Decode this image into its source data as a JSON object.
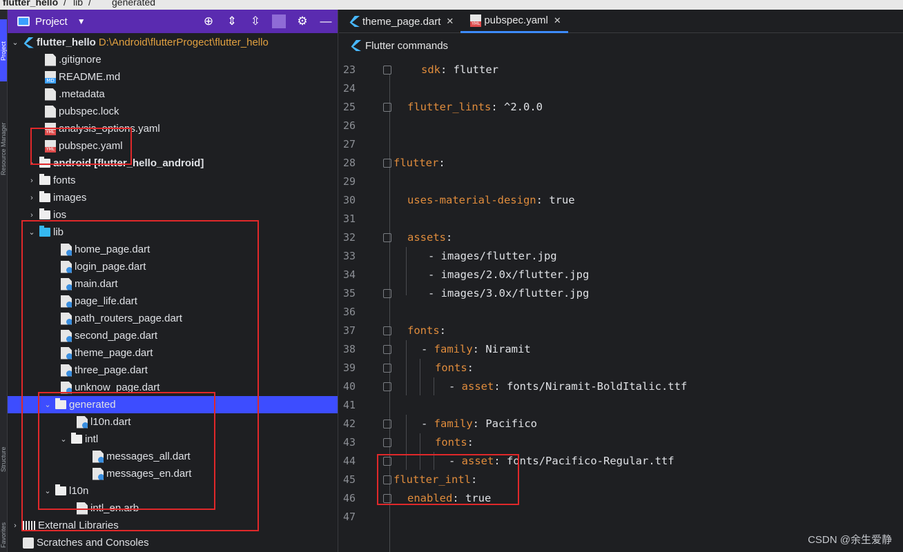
{
  "breadcrumb": {
    "items": [
      "flutter_hello",
      "lib",
      "generated"
    ]
  },
  "toolstrip": {
    "labels": [
      "Project",
      "Resource Manager",
      "Structure",
      "Favorites"
    ]
  },
  "project_panel": {
    "title": "Project",
    "tree": [
      {
        "label": "flutter_hello",
        "path": "D:\\Android\\flutterProgect\\flutter_hello",
        "icon": "flutter-icon",
        "arrow": "down"
      },
      {
        "label": ".gitignore",
        "icon": "file-icon"
      },
      {
        "label": "README.md",
        "icon": "markdown-icon"
      },
      {
        "label": ".metadata",
        "icon": "file-icon"
      },
      {
        "label": "pubspec.lock",
        "icon": "file-icon"
      },
      {
        "label": "analysis_options.yaml",
        "icon": "yaml-icon"
      },
      {
        "label": "pubspec.yaml",
        "icon": "yaml-icon"
      },
      {
        "label": "android [flutter_hello_android]",
        "icon": "folder-icon",
        "arrow": "right"
      },
      {
        "label": "fonts",
        "icon": "folder-icon",
        "arrow": "right"
      },
      {
        "label": "images",
        "icon": "folder-icon",
        "arrow": "right"
      },
      {
        "label": "ios",
        "icon": "folder-icon",
        "arrow": "right"
      },
      {
        "label": "lib",
        "icon": "folder-icon",
        "arrow": "down"
      },
      {
        "label": "home_page.dart",
        "icon": "dart-file-icon"
      },
      {
        "label": "login_page.dart",
        "icon": "dart-file-icon"
      },
      {
        "label": "main.dart",
        "icon": "dart-file-icon"
      },
      {
        "label": "page_life.dart",
        "icon": "dart-file-icon"
      },
      {
        "label": "path_routers_page.dart",
        "icon": "dart-file-icon"
      },
      {
        "label": "second_page.dart",
        "icon": "dart-file-icon"
      },
      {
        "label": "theme_page.dart",
        "icon": "dart-file-icon"
      },
      {
        "label": "three_page.dart",
        "icon": "dart-file-icon"
      },
      {
        "label": "unknow_page.dart",
        "icon": "dart-file-icon"
      },
      {
        "label": "generated",
        "icon": "folder-icon",
        "arrow": "down"
      },
      {
        "label": "l10n.dart",
        "icon": "dart-file-icon"
      },
      {
        "label": "intl",
        "icon": "folder-icon",
        "arrow": "down"
      },
      {
        "label": "messages_all.dart",
        "icon": "dart-file-icon"
      },
      {
        "label": "messages_en.dart",
        "icon": "dart-file-icon"
      },
      {
        "label": "l10n",
        "icon": "folder-icon",
        "arrow": "down"
      },
      {
        "label": "intl_en.arb",
        "icon": "file-icon"
      },
      {
        "label": "External Libraries",
        "icon": "libraries-icon",
        "arrow": "right"
      },
      {
        "label": "Scratches and Consoles",
        "icon": "scratches-icon"
      }
    ]
  },
  "editor": {
    "tabs": [
      {
        "label": "theme_page.dart",
        "icon": "dart-icon",
        "active": false
      },
      {
        "label": "pubspec.yaml",
        "icon": "yaml-icon",
        "active": true
      }
    ],
    "command_bar": "Flutter commands",
    "lines": [
      {
        "n": "23",
        "key": "sdk",
        "val": "flutter"
      },
      {
        "n": "24"
      },
      {
        "n": "25",
        "key": "flutter_lints",
        "val": "^2.0.0"
      },
      {
        "n": "26"
      },
      {
        "n": "27"
      },
      {
        "n": "28",
        "key": "flutter",
        "val": ""
      },
      {
        "n": "29"
      },
      {
        "n": "30",
        "key": "uses-material-design",
        "val": "true"
      },
      {
        "n": "31"
      },
      {
        "n": "32",
        "key": "assets",
        "val": ""
      },
      {
        "n": "33",
        "plain": "- images/flutter.jpg"
      },
      {
        "n": "34",
        "plain": "- images/2.0x/flutter.jpg"
      },
      {
        "n": "35",
        "plain": "- images/3.0x/flutter.jpg"
      },
      {
        "n": "36"
      },
      {
        "n": "37",
        "key": "fonts",
        "val": ""
      },
      {
        "n": "38",
        "dash": "- ",
        "key": "family",
        "val": "Niramit"
      },
      {
        "n": "39",
        "key": "fonts",
        "val": ""
      },
      {
        "n": "40",
        "dash": "- ",
        "key": "asset",
        "val": "fonts/Niramit-BoldItalic.ttf"
      },
      {
        "n": "41"
      },
      {
        "n": "42",
        "dash": "- ",
        "key": "family",
        "val": "Pacifico"
      },
      {
        "n": "43",
        "key": "fonts",
        "val": ""
      },
      {
        "n": "44",
        "dash": "- ",
        "key": "asset",
        "val": "fonts/Pacifico-Regular.ttf"
      },
      {
        "n": "45",
        "key": "flutter_intl",
        "val": ""
      },
      {
        "n": "46",
        "key": "enabled",
        "val": "true"
      },
      {
        "n": "47"
      }
    ]
  },
  "watermark": "CSDN @余生爱静",
  "colors": {
    "header": "#5a2bb0",
    "selection": "#3d4dff",
    "key": "#e08c3c",
    "highlight_box": "#e0282a"
  }
}
